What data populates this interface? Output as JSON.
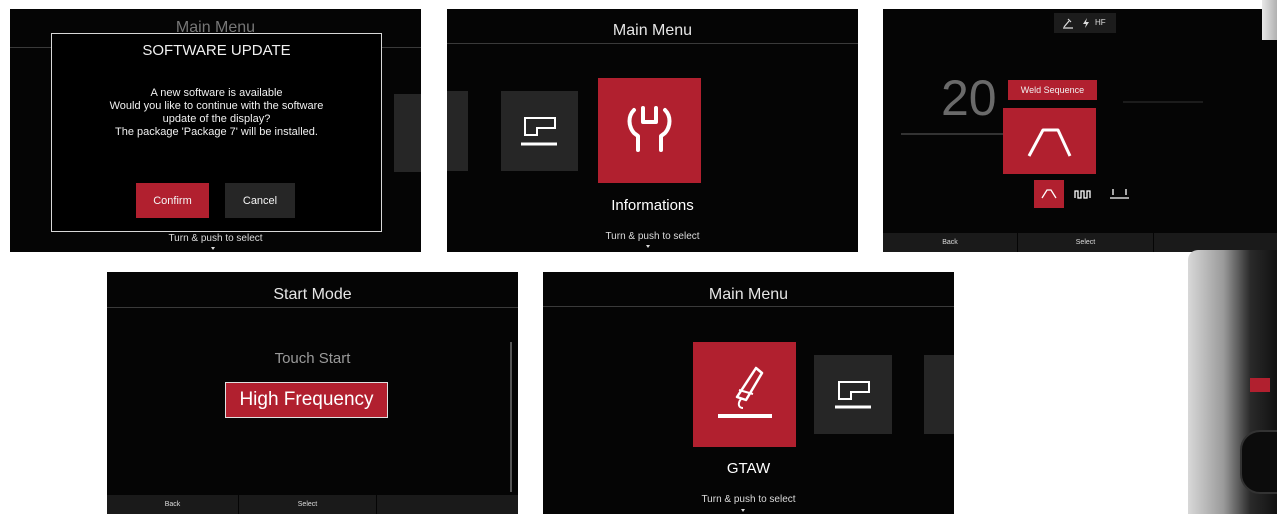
{
  "colors": {
    "accent": "#b1202f",
    "screen_bg": "#050505",
    "tile_bg": "#262626"
  },
  "screen1": {
    "header": "Main Menu",
    "dialog": {
      "title": "SOFTWARE UPDATE",
      "lines": [
        "A new software is available",
        "Would you like to continue with the software",
        "update of the display?",
        "The package 'Package 7' will be installed."
      ],
      "confirm_label": "Confirm",
      "cancel_label": "Cancel"
    },
    "hint": "Turn & push to select"
  },
  "screen2": {
    "header": "Main Menu",
    "selected_label": "Informations",
    "hint": "Turn & push to select",
    "icons": [
      "torch-icon",
      "wrench-icon"
    ]
  },
  "screen3": {
    "status": {
      "hf": "HF"
    },
    "big_value": "20",
    "tooltip": "Weld Sequence",
    "options": [
      "slope-icon",
      "pulse-icon",
      "spot-icon"
    ],
    "footer": {
      "back": "Back",
      "select": "Select"
    }
  },
  "screen4": {
    "header": "Start Mode",
    "options": [
      "Touch Start",
      "High Frequency"
    ],
    "selected_index": 1,
    "footer": {
      "back": "Back",
      "select": "Select"
    }
  },
  "screen5": {
    "header": "Main Menu",
    "selected_label": "GTAW",
    "hint": "Turn & push to select",
    "icons": [
      "tig-torch-icon",
      "torch-icon"
    ]
  }
}
